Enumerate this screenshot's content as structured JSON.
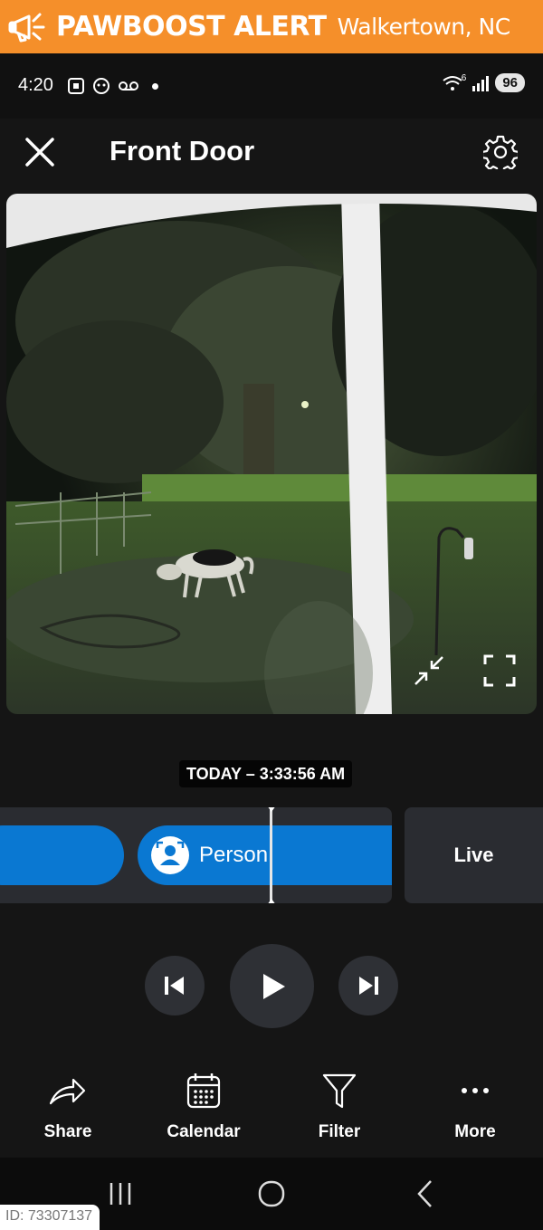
{
  "banner": {
    "brand": "PAWBOOST ALERT",
    "location": "Walkertown, NC",
    "icon": "megaphone-icon",
    "color": "#f58f2a"
  },
  "status_bar": {
    "time": "4:20",
    "battery": "96",
    "wifi_label": "6"
  },
  "header": {
    "title": "Front Door"
  },
  "video": {
    "timestamp": "TODAY – 3:33:56 AM"
  },
  "timeline": {
    "event_label": "Person",
    "live_label": "Live",
    "accent": "#0a78d2"
  },
  "actions": [
    {
      "label": "Share",
      "icon": "share-icon"
    },
    {
      "label": "Calendar",
      "icon": "calendar-icon"
    },
    {
      "label": "Filter",
      "icon": "filter-icon"
    },
    {
      "label": "More",
      "icon": "more-icon"
    }
  ],
  "id_tag": "ID: 73307137"
}
